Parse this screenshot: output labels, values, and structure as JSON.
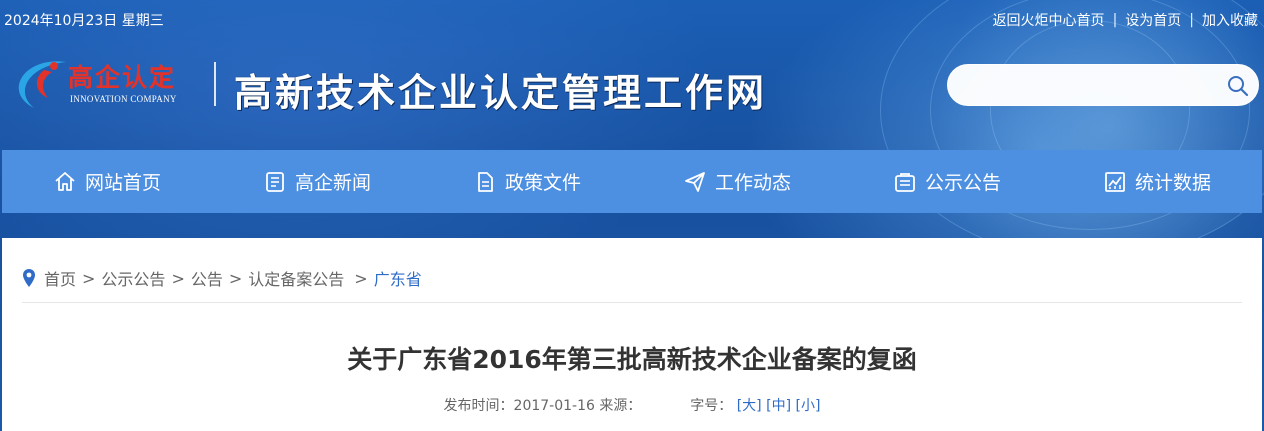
{
  "topbar": {
    "date": "2024年10月23日 星期三",
    "links": [
      "返回火炬中心首页",
      "设为首页",
      "加入收藏"
    ],
    "separator": "|"
  },
  "logo": {
    "cn": "高企认定",
    "en": "INNOVATION COMPANY",
    "site_title": "高新技术企业认定管理工作网"
  },
  "search": {
    "placeholder": "",
    "icon": "search-icon"
  },
  "nav": {
    "items": [
      {
        "label": "网站首页",
        "icon": "home-icon"
      },
      {
        "label": "高企新闻",
        "icon": "news-icon"
      },
      {
        "label": "政策文件",
        "icon": "document-icon"
      },
      {
        "label": "工作动态",
        "icon": "paper-plane-icon"
      },
      {
        "label": "公示公告",
        "icon": "announcement-icon"
      },
      {
        "label": "统计数据",
        "icon": "chart-icon"
      }
    ]
  },
  "breadcrumb": {
    "items": [
      "首页",
      "公示公告",
      "公告",
      "认定备案公告"
    ],
    "current": "广东省",
    "separator": ">"
  },
  "article": {
    "title": "关于广东省2016年第三批高新技术企业备案的复函",
    "publish_label": "发布时间：2017-01-16 来源：",
    "font_label": "字号：",
    "font_sizes": [
      "[大]",
      "[中]",
      "[小]"
    ]
  },
  "colors": {
    "nav_bg": "#4d8fe0",
    "logo_red": "#e3322a",
    "link_blue": "#2f6cc8"
  }
}
